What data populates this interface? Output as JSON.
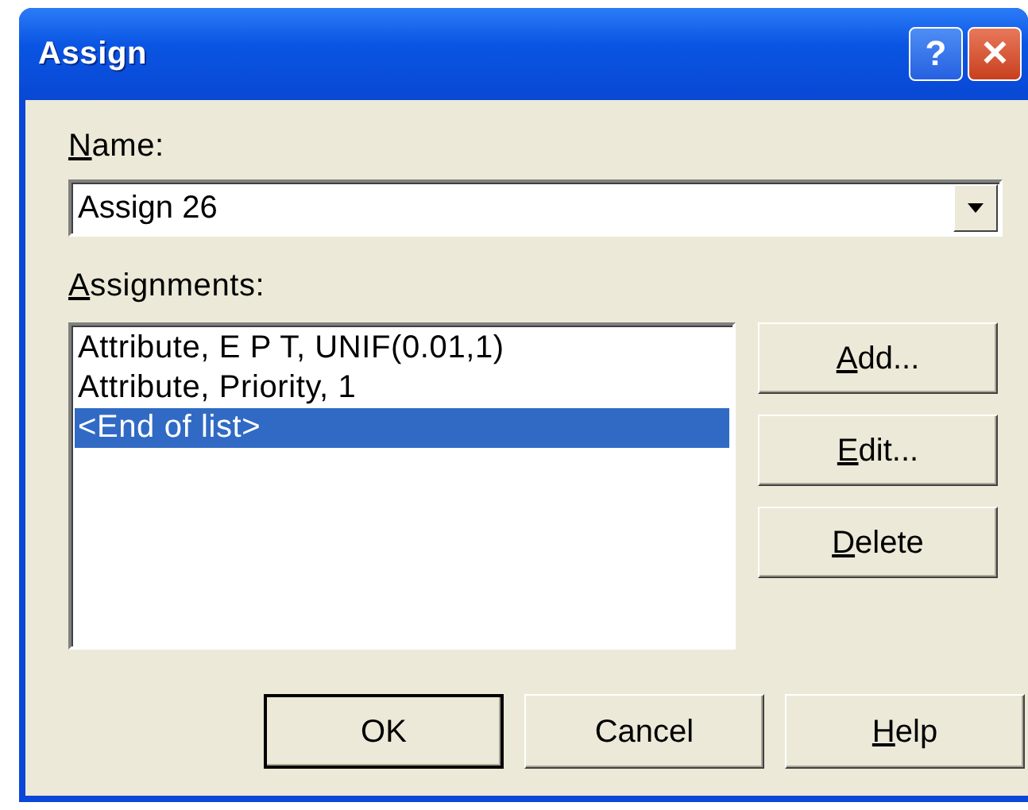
{
  "window": {
    "title": "Assign",
    "title_buttons": [
      {
        "kind": "help",
        "label": "?"
      },
      {
        "kind": "close",
        "label": "✕"
      }
    ]
  },
  "name_field": {
    "label": "Name:",
    "mnemonic": true,
    "value": "Assign 26"
  },
  "assignments": {
    "label": "Assignments:",
    "mnemonic": true,
    "items": [
      {
        "text": "Attribute, E P T, UNIF(0.01,1)",
        "selected": false
      },
      {
        "text": "Attribute, Priority, 1",
        "selected": false
      },
      {
        "text": "<End of list>",
        "selected": true
      }
    ]
  },
  "side_buttons": [
    {
      "label": "Add...",
      "mnemonic": true
    },
    {
      "label": "Edit...",
      "mnemonic": true
    },
    {
      "label": "Delete",
      "mnemonic": true
    }
  ],
  "buttons": [
    {
      "label": "OK",
      "mnemonic": false,
      "default": true
    },
    {
      "label": "Cancel",
      "mnemonic": false,
      "default": false
    },
    {
      "label": "Help",
      "mnemonic": true,
      "default": false
    }
  ]
}
